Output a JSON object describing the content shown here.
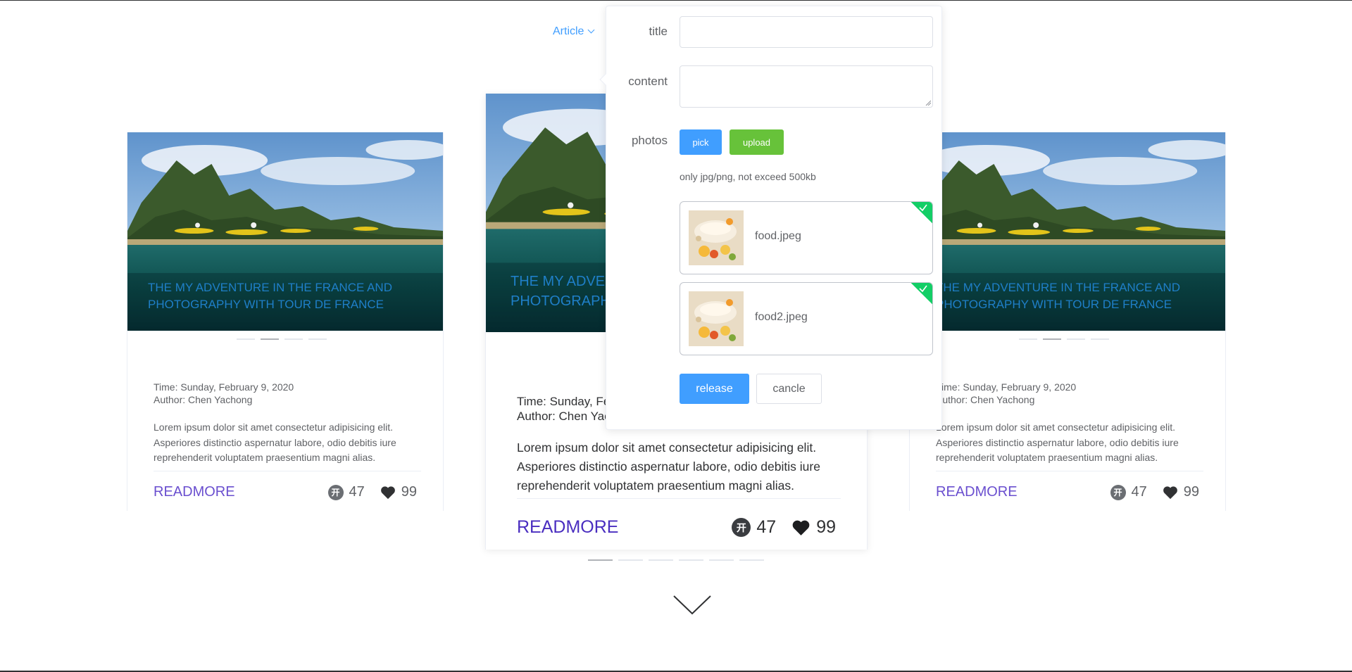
{
  "nav": {
    "article_menu": "Article"
  },
  "cards": [
    {
      "title": "THE MY ADVENTURE IN THE FRANCE AND PHOTOGRAPHY WITH TOUR DE FRANCE",
      "time": "Time: Sunday, February 9, 2020",
      "author": "Author: Chen Yachong",
      "description": "Lorem ipsum dolor sit amet consectetur adipisicing elit. Asperiores distinctio aspernatur labore, odio debitis iure reprehenderit voluptatem praesentium magni alias.",
      "readmore": "READMORE",
      "coins": "47",
      "likes": "99"
    },
    {
      "title": "THE MY ADVENTURE IN THE FRANCE AND PHOTOGRAPHY WITH TOUR DE FRANCE",
      "time": "Time: Sunday, February 9, 2020",
      "author": "Author: Chen Yachong",
      "description": "Lorem ipsum dolor sit amet consectetur adipisicing elit. Asperiores distinctio aspernatur labore, odio debitis iure reprehenderit voluptatem praesentium magni alias.",
      "readmore": "READMORE",
      "coins": "47",
      "likes": "99"
    },
    {
      "title": "THE MY ADVENTURE IN THE FRANCE AND PHOTOGRAPHY WITH TOUR DE FRANCE",
      "time": "Time: Sunday, February 9, 2020",
      "author": "Author: Chen Yachong",
      "description": "Lorem ipsum dolor sit amet consectetur adipisicing elit. Asperiores distinctio aspernatur labore, odio debitis iure reprehenderit voluptatem praesentium magni alias.",
      "readmore": "READMORE",
      "coins": "47",
      "likes": "99"
    }
  ],
  "coin_glyph": "开",
  "form": {
    "title_label": "title",
    "content_label": "content",
    "photos_label": "photos",
    "title_value": "",
    "content_value": "",
    "pick_label": "pick",
    "upload_label": "upload",
    "hint": "only jpg/png, not exceed 500kb",
    "files": [
      {
        "name": "food.jpeg",
        "status": "success"
      },
      {
        "name": "food2.jpeg",
        "status": "success"
      }
    ],
    "release_label": "release",
    "cancel_label": "cancle"
  },
  "colors": {
    "primary": "#409eff",
    "success": "#67c23a",
    "upload_check": "#13ce66",
    "readmore": "#6a4fcf",
    "overlay_title": "#1f7fc8"
  },
  "icons": {
    "menu_chevron": "chevron-down-icon",
    "coin": "coin-icon",
    "like": "heart-icon",
    "scroll_down": "chevron-down-large-icon",
    "file_ok": "check-icon"
  }
}
